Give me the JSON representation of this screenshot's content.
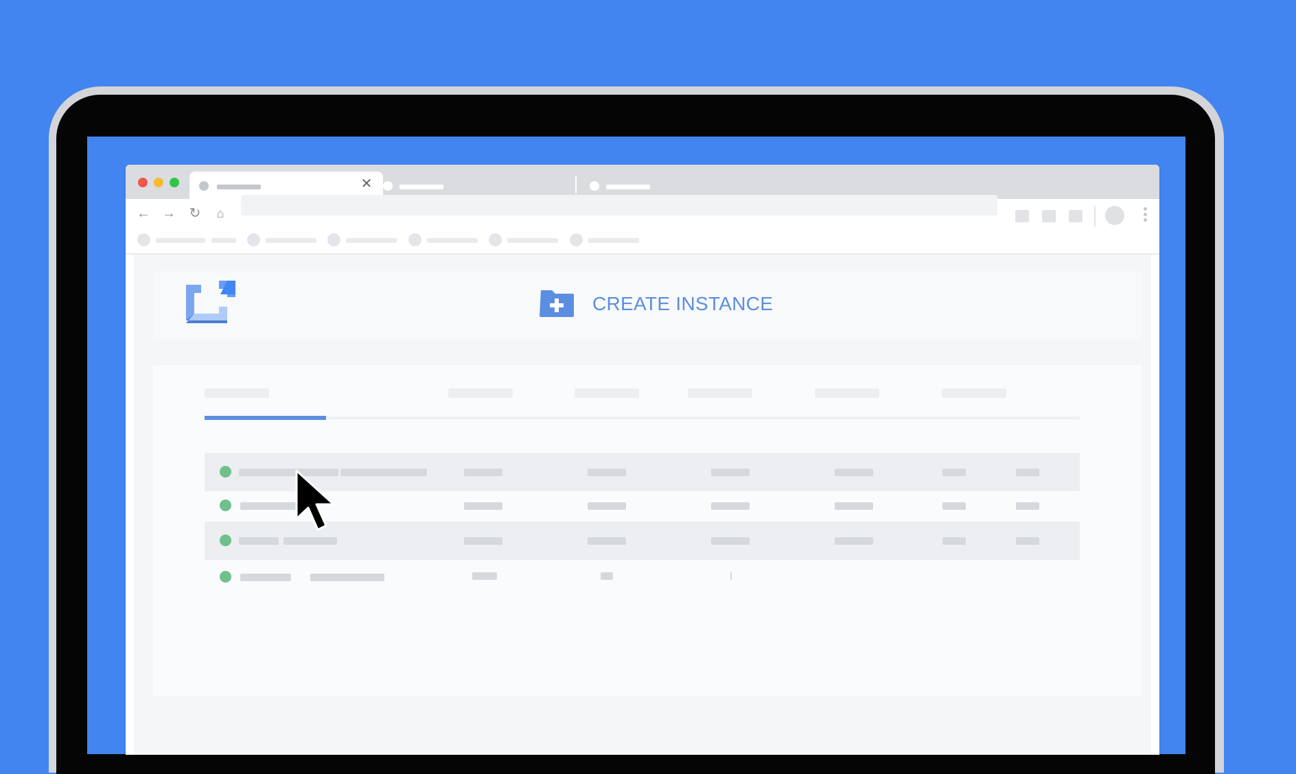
{
  "scene": {
    "background_color": "#4285f0",
    "device": "laptop"
  },
  "browser": {
    "window_controls": [
      "close",
      "minimize",
      "zoom"
    ],
    "tabs": [
      {
        "state": "active",
        "closable": true
      },
      {
        "state": "inactive"
      },
      {
        "state": "inactive"
      }
    ],
    "toolbar": {
      "icons": [
        "back-arrow-icon",
        "forward-arrow-icon",
        "reload-icon",
        "home-icon"
      ],
      "menu_icon": "more-vert-icon"
    }
  },
  "app": {
    "logo_icon": "compute-logo-icon",
    "create_button": {
      "label": "CREATE INSTANCE",
      "icon": "folder-add-icon",
      "color": "#5b8ee0"
    },
    "table": {
      "tab_indicator_color": "#5b8ee0",
      "rows": [
        {
          "status": "running",
          "status_color": "#6fc08c"
        },
        {
          "status": "running",
          "status_color": "#6fc08c"
        },
        {
          "status": "running",
          "status_color": "#6fc08c"
        },
        {
          "status": "running",
          "status_color": "#6fc08c"
        }
      ]
    }
  },
  "pointer": {
    "icon": "mouse-cursor-icon"
  }
}
